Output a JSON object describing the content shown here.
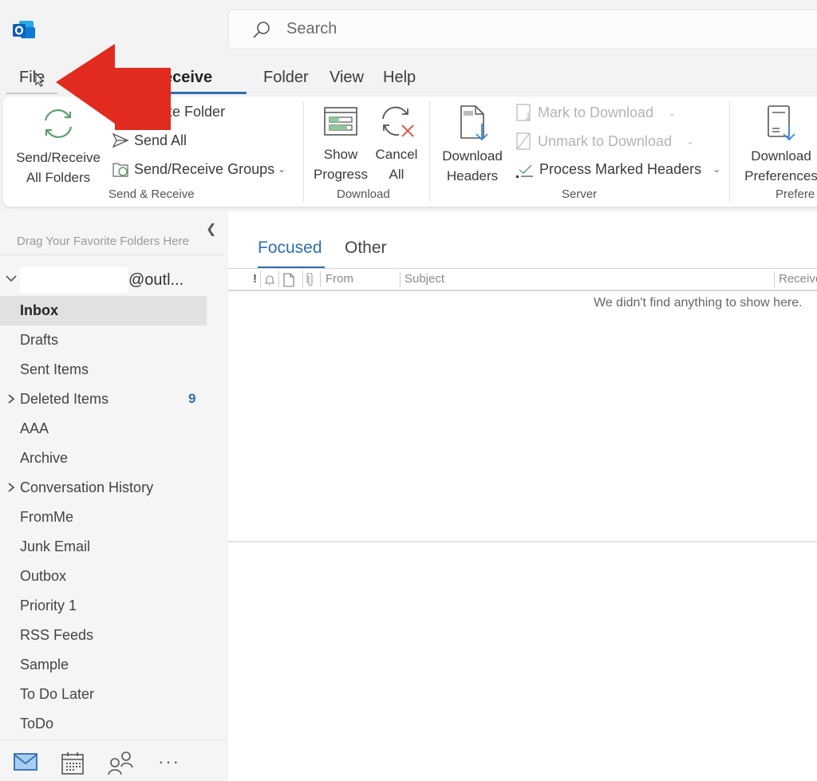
{
  "app": {
    "name": "Outlook",
    "icon": "outlook-logo-icon",
    "brand_color": "#0f6cbd"
  },
  "search": {
    "placeholder": "Search",
    "icon": "search-icon"
  },
  "menu_tabs": [
    {
      "label": "File",
      "active": false
    },
    {
      "label": "Send / Receive",
      "active": true
    },
    {
      "label": "Folder",
      "active": false
    },
    {
      "label": "View",
      "active": false
    },
    {
      "label": "Help",
      "active": false
    }
  ],
  "menu_visible_fragment": "d / Receive",
  "ribbon": {
    "groups": [
      {
        "label": "Send & Receive",
        "big_buttons": [
          {
            "label_line1": "Send/Receive",
            "label_line2": "All Folders",
            "icon": "sync-icon"
          }
        ],
        "small_buttons": [
          {
            "label": "Update Folder",
            "icon": "folder-sync-icon"
          },
          {
            "label": "Send All",
            "icon": "send-icon"
          },
          {
            "label": "Send/Receive Groups",
            "icon": "folder-sync-icon",
            "has_dropdown": true
          }
        ]
      },
      {
        "label": "Download",
        "big_buttons": [
          {
            "label_line1": "Show",
            "label_line2": "Progress",
            "icon": "progress-icon"
          },
          {
            "label_line1": "Cancel",
            "label_line2": "All",
            "icon": "cancel-sync-icon"
          }
        ]
      },
      {
        "label": "Server",
        "big_buttons": [
          {
            "label_line1": "Download",
            "label_line2": "Headers",
            "icon": "download-headers-icon"
          }
        ],
        "small_buttons": [
          {
            "label": "Mark to Download",
            "icon": "mark-download-icon",
            "has_dropdown": true,
            "disabled": true
          },
          {
            "label": "Unmark to Download",
            "icon": "unmark-download-icon",
            "has_dropdown": true,
            "disabled": true
          },
          {
            "label": "Process Marked Headers",
            "icon": "process-headers-icon",
            "has_dropdown": true,
            "disabled": false
          }
        ]
      },
      {
        "label": "Preferences",
        "label_visible": "Prefere",
        "big_buttons": [
          {
            "label_line1": "Download",
            "label_line2": "Preferences",
            "icon": "download-preferences-icon"
          }
        ]
      }
    ]
  },
  "folder_pane": {
    "favorites_hint": "Drag Your Favorite Folders Here",
    "account": {
      "suffix": "@outl..."
    },
    "folders": [
      {
        "name": "Inbox",
        "selected": true
      },
      {
        "name": "Drafts"
      },
      {
        "name": "Sent Items"
      },
      {
        "name": "Deleted Items",
        "expandable": true,
        "count": "9"
      },
      {
        "name": "AAA"
      },
      {
        "name": "Archive"
      },
      {
        "name": "Conversation History",
        "expandable": true
      },
      {
        "name": "FromMe"
      },
      {
        "name": "Junk Email"
      },
      {
        "name": "Outbox"
      },
      {
        "name": "Priority 1"
      },
      {
        "name": "RSS Feeds"
      },
      {
        "name": "Sample"
      },
      {
        "name": "To Do Later"
      },
      {
        "name": "ToDo"
      }
    ]
  },
  "nav_bar": [
    {
      "name": "Mail",
      "icon": "mail-icon",
      "active": true
    },
    {
      "name": "Calendar",
      "icon": "calendar-icon"
    },
    {
      "name": "People",
      "icon": "people-icon"
    },
    {
      "name": "More",
      "icon": "more-icon",
      "glyph": "···"
    }
  ],
  "message_list": {
    "tabs": [
      {
        "label": "Focused",
        "active": true
      },
      {
        "label": "Other",
        "active": false
      }
    ],
    "columns": {
      "importance": "!",
      "from": "From",
      "subject": "Subject",
      "received": "Receive"
    },
    "empty_text": "We didn't find anything to show here."
  },
  "colors": {
    "accent": "#2f6fb3",
    "sync_green": "#5a9e6f",
    "arrow_red": "#e12b1f"
  }
}
